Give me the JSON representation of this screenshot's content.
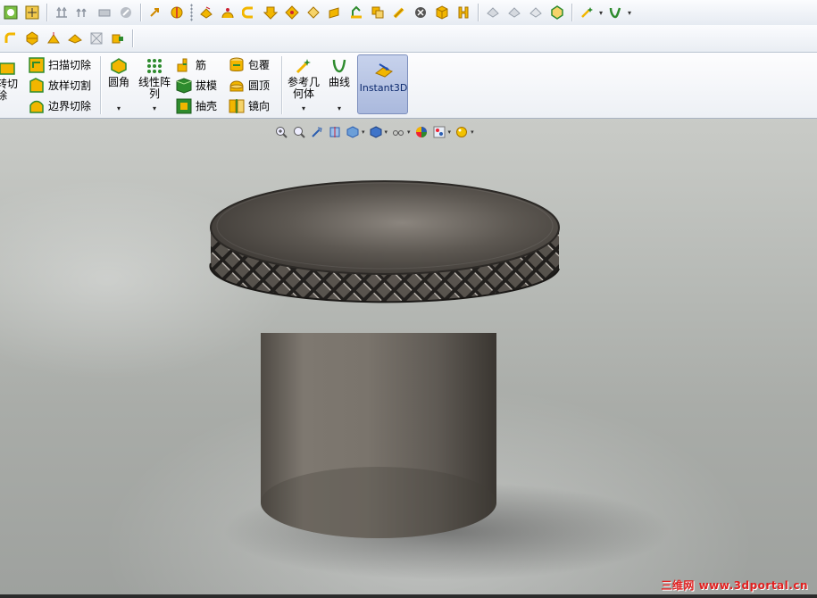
{
  "toolbar_row1": {
    "icons": [
      "sketch-icon",
      "smart-dimension-icon",
      "extruded-boss-icon",
      "revolved-boss-icon",
      "rebuild-icon",
      "cancel-icon",
      "arrow-icon",
      "section-view-icon",
      "plane-icon",
      "dome-icon",
      "flex-icon",
      "indent-icon",
      "wrap-icon",
      "deform-icon",
      "shell-icon",
      "intersect-icon",
      "cube-icon",
      "mirror-icon",
      "reference-icon",
      "curve-icon",
      "instant-icon"
    ]
  },
  "toolbar_row2": {
    "icons": [
      "fillet-icon",
      "chamfer-icon",
      "draft-icon",
      "dome-icon",
      "scale-icon",
      "combine-icon"
    ]
  },
  "ribbon": {
    "revolved_cut": {
      "label_line1": "转切",
      "label_line2": "除"
    },
    "swept_cut": "扫描切除",
    "lofted_cut": "放样切割",
    "boundary_cut": "边界切除",
    "fillet": "圆角",
    "linear_pattern": {
      "line1": "线性阵",
      "line2": "列"
    },
    "rib": "筋",
    "draft": "拔模",
    "shell": "抽壳",
    "wrap": "包覆",
    "dome": "圆顶",
    "mirror": "镜向",
    "reference_geometry": {
      "line1": "参考几",
      "line2": "何体"
    },
    "curves": "曲线",
    "instant3d": "Instant3D",
    "caret": "▾"
  },
  "heads_up": {
    "icons": [
      "zoom-to-fit-icon",
      "zoom-area-icon",
      "previous-view-icon",
      "section-view-icon",
      "view-orientation-icon",
      "display-style-icon",
      "hide-show-icon",
      "appearance-icon",
      "scene-icon",
      "view-settings-icon"
    ]
  },
  "watermark": "三维网 www.3dportal.cn",
  "colors": {
    "accent": "#f2b600",
    "instant3d": "#aab9dd",
    "watermark": "#e02020"
  }
}
